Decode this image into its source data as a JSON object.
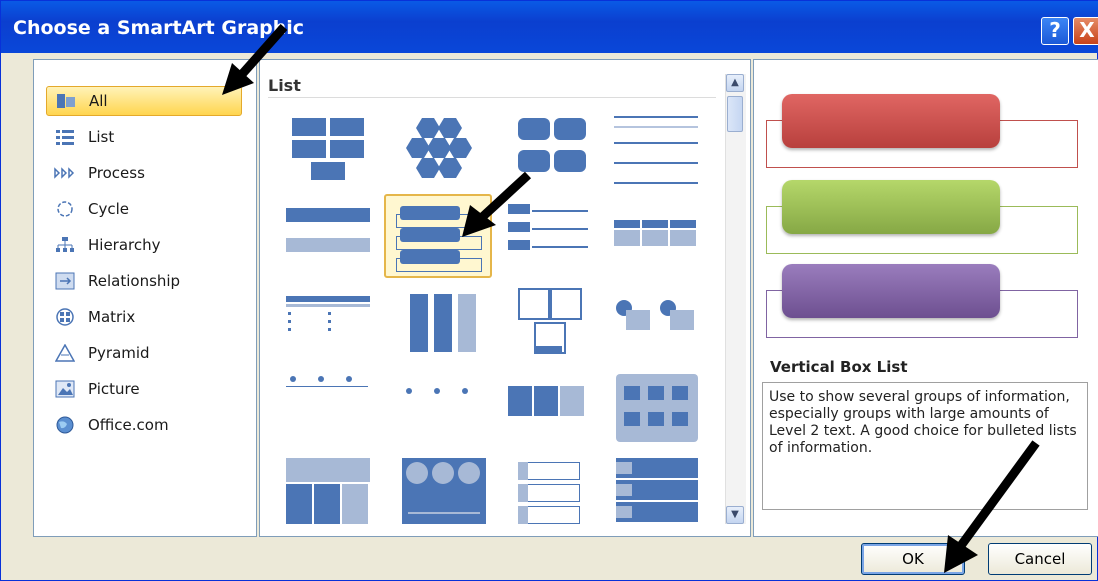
{
  "window": {
    "title": "Choose a SmartArt Graphic",
    "help_label": "?",
    "close_label": "X"
  },
  "categories": [
    {
      "label": "All",
      "icon": "all-icon"
    },
    {
      "label": "List",
      "icon": "list-icon"
    },
    {
      "label": "Process",
      "icon": "process-icon"
    },
    {
      "label": "Cycle",
      "icon": "cycle-icon"
    },
    {
      "label": "Hierarchy",
      "icon": "hierarchy-icon"
    },
    {
      "label": "Relationship",
      "icon": "relationship-icon"
    },
    {
      "label": "Matrix",
      "icon": "matrix-icon"
    },
    {
      "label": "Pyramid",
      "icon": "pyramid-icon"
    },
    {
      "label": "Picture",
      "icon": "picture-icon"
    },
    {
      "label": "Office.com",
      "icon": "globe-icon"
    }
  ],
  "gallery": {
    "header": "List",
    "selected_index": 5
  },
  "preview": {
    "title": "Vertical Box List",
    "description": "Use to show several groups of information, especially groups with large amounts of Level 2 text. A good choice for bulleted lists of information.",
    "colors": [
      "#c0504d",
      "#9bbb59",
      "#8064a2"
    ]
  },
  "buttons": {
    "ok": "OK",
    "cancel": "Cancel"
  }
}
